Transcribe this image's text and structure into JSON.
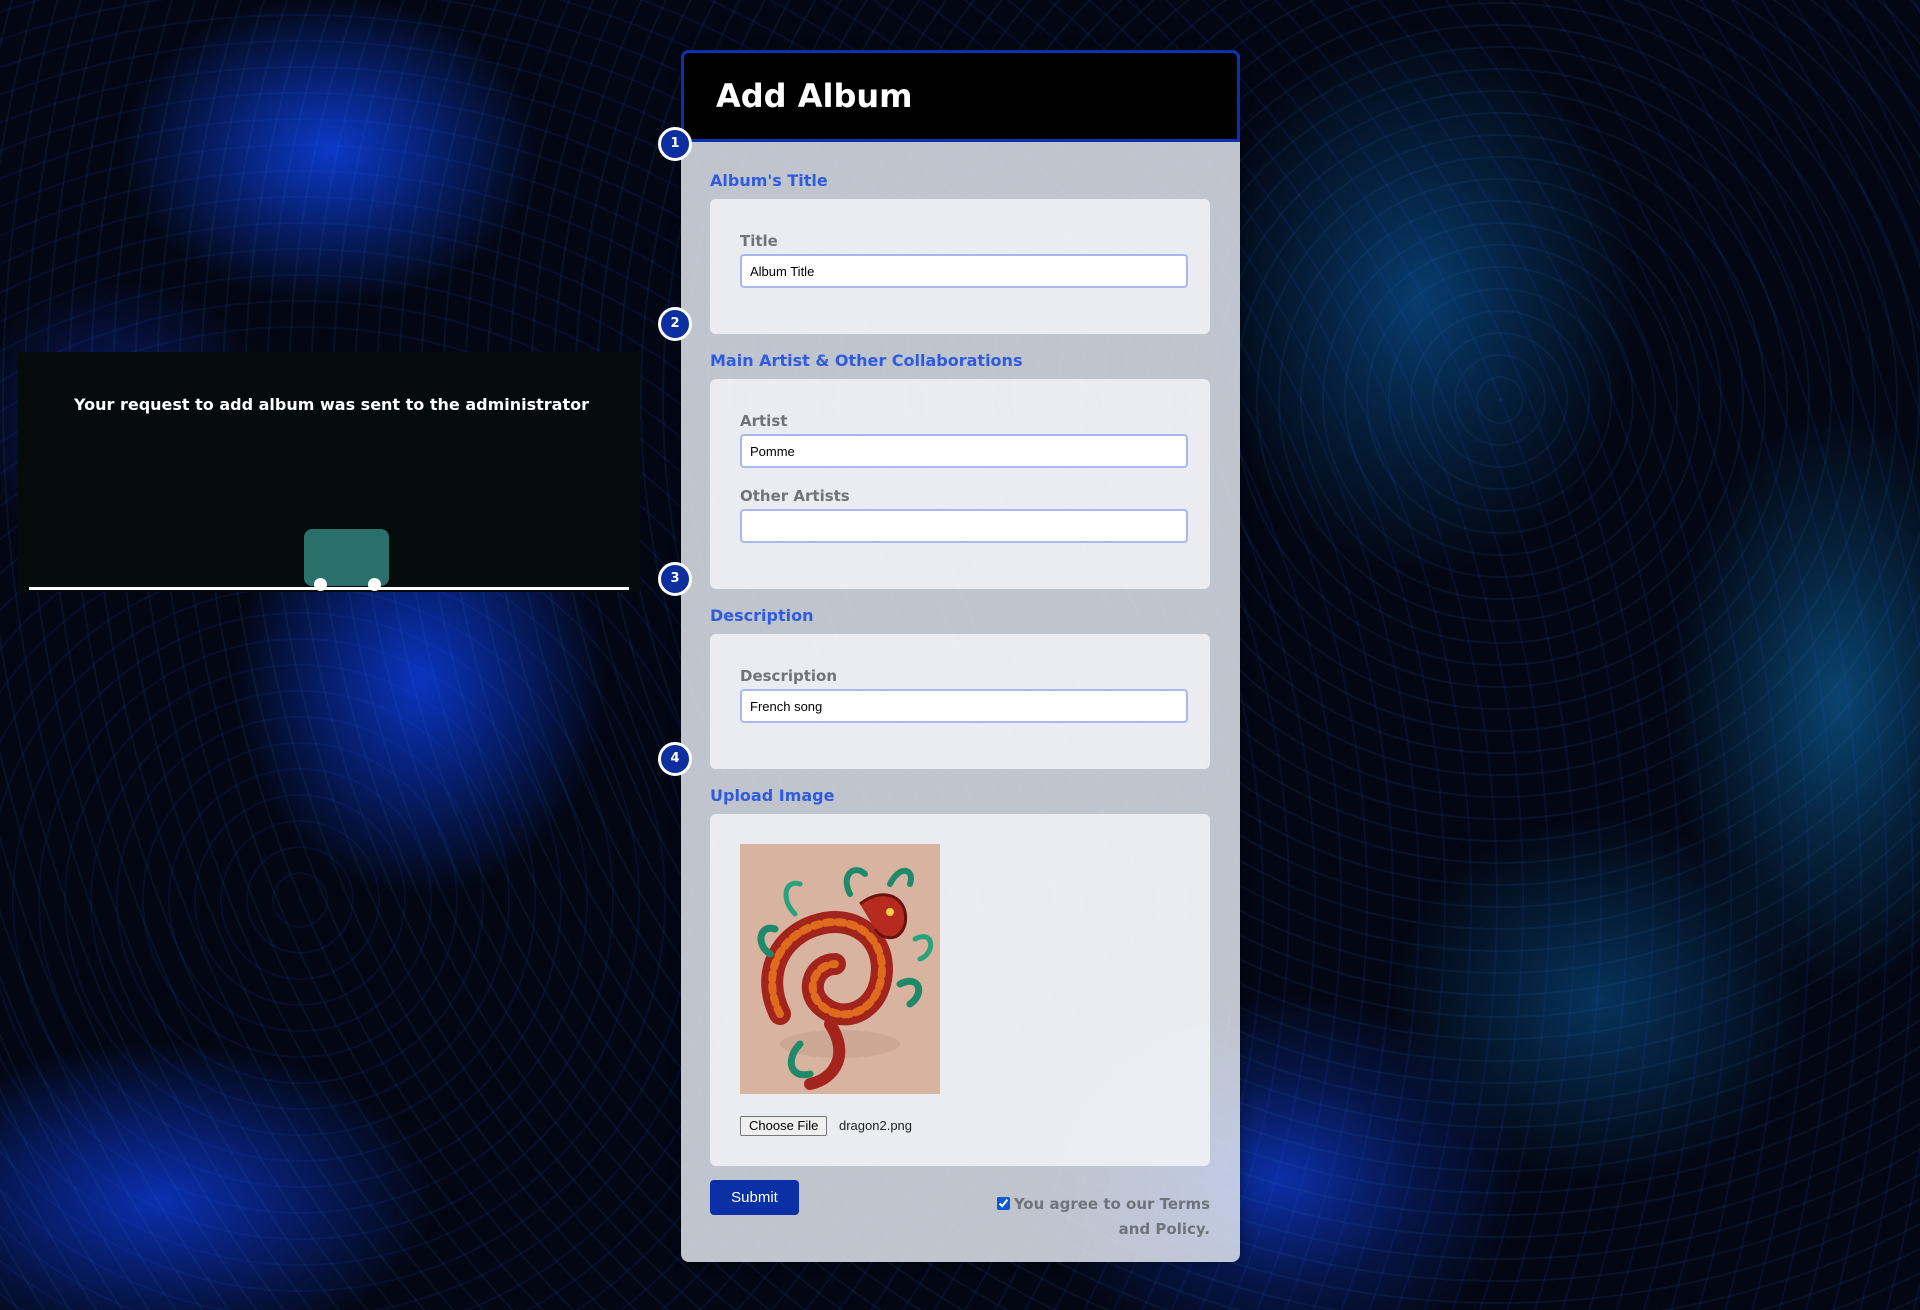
{
  "notification": {
    "message": "Your request to add album was sent to the administrator"
  },
  "form": {
    "title": "Add Album",
    "sections": [
      {
        "step": "1",
        "title": "Album's Title"
      },
      {
        "step": "2",
        "title": "Main Artist & Other Collaborations"
      },
      {
        "step": "3",
        "title": "Description"
      },
      {
        "step": "4",
        "title": "Upload Image"
      }
    ],
    "fields": {
      "title": {
        "label": "Title",
        "value": "Album Title"
      },
      "artist": {
        "label": "Artist",
        "value": "Pomme"
      },
      "other_artists": {
        "label": "Other Artists",
        "value": ""
      },
      "description": {
        "label": "Description",
        "value": "French song"
      }
    },
    "upload": {
      "button_label": "Choose File",
      "file_name": "dragon2.png"
    },
    "submit_label": "Submit",
    "terms_label": "You agree to our Terms and Policy.",
    "terms_checked": true
  },
  "colors": {
    "accent": "#2f5be0",
    "header_border": "#0c2fb0",
    "submit": "#0b2fa5",
    "notice_bg": "#050b0b",
    "truck": "#2a6f6a"
  }
}
